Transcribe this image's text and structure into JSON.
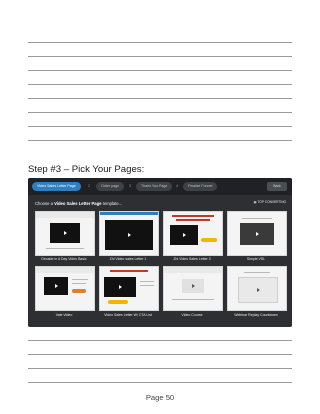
{
  "heading": "Step #3 – Pick Your Pages:",
  "page_number": "Page 50",
  "screenshot": {
    "steps": [
      "Video Sales Letter Page",
      "Order page",
      "Thank You Page",
      "Finalize Funnel"
    ],
    "step_numbers": [
      "1",
      "2",
      "3",
      "4"
    ],
    "right_button": "Back",
    "choose_prefix": "Choose a ",
    "choose_bold": "Video Sales Letter Page",
    "choose_suffix": " template...",
    "top_converting": "TOP CONVERTING",
    "templates": [
      "Decade in A Day Video Basic",
      "Zhi Video sales Letter 1",
      "Zhi Video Sales Letter 3",
      "Simple VSL",
      "Vale Video",
      "Video Sales Letter W/ CTA List",
      "Video Course",
      "Webinar Replay Countdown"
    ]
  }
}
